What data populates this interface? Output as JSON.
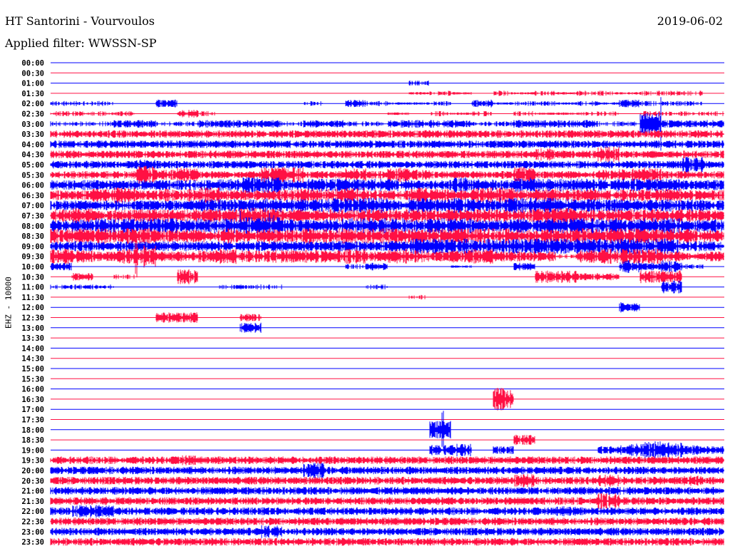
{
  "header": {
    "title": "HT Santorini - Vourvoulos",
    "filter": "Applied filter: WWSSN-SP",
    "date": "2019-06-02"
  },
  "chart_data": {
    "type": "line",
    "title": "HT Santorini - Vourvoulos",
    "ylabel": "EHZ - 10000",
    "colors": [
      "#0000ff",
      "#ff1043"
    ],
    "row_labels": [
      "00:00",
      "00:30",
      "01:00",
      "01:30",
      "02:00",
      "02:30",
      "03:00",
      "03:30",
      "04:00",
      "04:30",
      "05:00",
      "05:30",
      "06:00",
      "06:30",
      "07:00",
      "07:30",
      "08:00",
      "08:30",
      "09:00",
      "09:30",
      "10:00",
      "10:30",
      "11:00",
      "11:30",
      "12:00",
      "12:30",
      "13:00",
      "13:30",
      "14:00",
      "14:30",
      "15:00",
      "15:30",
      "16:00",
      "16:30",
      "17:00",
      "17:30",
      "18:00",
      "18:30",
      "19:00",
      "19:30",
      "20:00",
      "20:30",
      "21:00",
      "21:30",
      "22:00",
      "22:30",
      "23:00",
      "23:30"
    ],
    "activity_note": "relative amplitude 0-9 per 1/32 of each 30-minute row",
    "activity": [
      "00000000000000000000000000000000",
      "00000000000000000000000000000000",
      "00000000000000000200000000000000",
      "00000000000000000121021212212220",
      "22200300000020321120312212132220",
      "22220032000000001021202112202222",
      "22233223333233223333223333229333",
      "33333333333333333333333333333333",
      "33333333333333333333333333333333",
      "33333333333333333333333533633333",
      "33334333333333333333333333333363",
      "33337463336633536433336333456333",
      "44444444566455555446546555555544",
      "44564557444555644654664555455544",
      "44444445556556664656566655555554",
      "56455555566555555555555665555555",
      "55666656677556666566556666656655",
      "66666555656566666666665556666665",
      "44444444444444444666666666666644",
      "65467445655555646545644425666434",
      "30000000000000230001003000053520",
      "03020060000000000000000553305500",
      "22200000222000020000000000000500",
      "00000000000000000200000000000000",
      "00000000000000000000000000040000",
      "00000440030000000000000000000000",
      "00000000040000000000000000000000",
      "00000000000000000000000000000000",
      "00000000000000000000000000000000",
      "00000000000000000000000000000000",
      "00000000000000000000000000000000",
      "00000000000000000000000000000000",
      "00000000000000000000000000000000",
      "00000000000000000000090000000000",
      "00000000000000000000000000000000",
      "00000000000000000000000000000000",
      "00000000000000000070000000000000",
      "00000000000000000000004000000000",
      "00000000000000000045030000357643",
      "33333343333333333333333333333333",
      "33333333333363333333333333333333",
      "33333333333333333333335333533343",
      "33333333333333333333333333333333",
      "33333333333333333333333333633333",
      "35533333333333333333333343333333",
      "33333333333333333333333333333333",
      "33333333335333333333333333333333",
      "33333333333333333333333333333333"
    ]
  }
}
